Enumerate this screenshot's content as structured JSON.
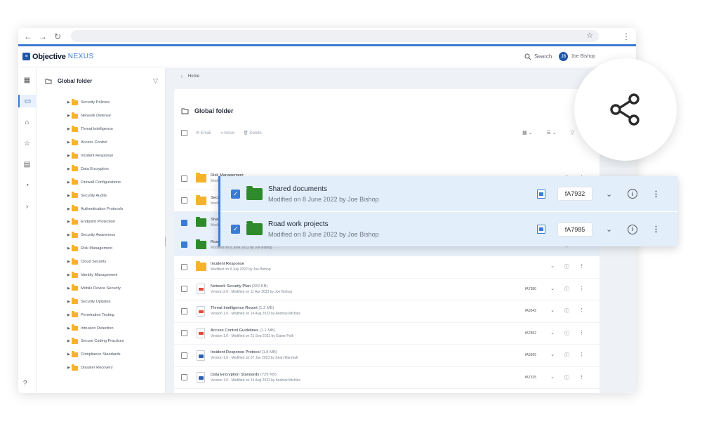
{
  "app": {
    "logo_mark": "≡",
    "logo_primary": "Objective",
    "logo_secondary": "NEXUS",
    "search_label": "Search",
    "user_initials": "JB",
    "user_name": "Joe Bishop"
  },
  "breadcrumb": {
    "label": "Home"
  },
  "tree": {
    "title": "Global folder",
    "items": [
      "Security Policies",
      "Network Defense",
      "Threat Intelligence",
      "Access Control",
      "Incident Response",
      "Data Encryption",
      "Firewall Configurations",
      "Security Audits",
      "Authentication Protocols",
      "Endpoint Protection",
      "Security Awareness",
      "Risk Management",
      "Cloud Security",
      "Identity Management",
      "Mobile Device Security",
      "Security Updates",
      "Penetration Testing",
      "Intrusion Detection",
      "Secure Coding Practices",
      "Compliance Standards",
      "Disaster Recovery"
    ]
  },
  "panel": {
    "title": "Global folder",
    "toolbar": {
      "email": "Email",
      "move": "Move",
      "delete": "Delete"
    }
  },
  "rows": [
    {
      "type": "folder-y",
      "name": "Risk Management",
      "size": "",
      "meta": "Modified on 23 July 2020 by Joe Bishop",
      "id": "fA7932",
      "selected": false
    },
    {
      "type": "folder-y",
      "name": "Security Audits",
      "size": "",
      "meta": "Modified on 8 June 2022 by Joe Bishop",
      "id": "fA7935",
      "selected": false
    },
    {
      "type": "folder-g",
      "name": "Shared documents",
      "size": "",
      "meta": "Modified on 8 June 2022 by Joe Bishop",
      "id": "",
      "selected": true
    },
    {
      "type": "folder-g",
      "name": "Road work projects",
      "size": "",
      "meta": "Modified on 8 June 2022 by Joe Bishop",
      "id": "",
      "selected": true
    },
    {
      "type": "folder-y",
      "name": "Incident Response",
      "size": "",
      "meta": "Modified on 8 July 2022 by Joe Bishop",
      "id": "",
      "selected": false
    },
    {
      "type": "pdf",
      "name": "Network Security Plan",
      "size": "(332 KB)",
      "meta": "Version 2.0 - Modified on 11 Apr 2023 by Joe Bishop",
      "id": "fA7380",
      "selected": false
    },
    {
      "type": "pdf",
      "name": "Threat Intelligence Report",
      "size": "(1.2 MB)",
      "meta": "Version 1.0 - Modified on 14 Aug 2023 by Andrew Michles",
      "id": "fA9342",
      "selected": false
    },
    {
      "type": "pdf",
      "name": "Access Control Guidelines",
      "size": "(1.1 MB)",
      "meta": "Version 1.0 - Modified on 21 Sep 2023 by Elaine Polk",
      "id": "fA7852",
      "selected": false
    },
    {
      "type": "doc",
      "name": "Incident Response Protocol",
      "size": "(1.8 MB)",
      "meta": "Version 1.0 - Modified on 07 Jun 2023 by Sean Marshall",
      "id": "fA9365",
      "selected": false
    },
    {
      "type": "doc",
      "name": "Data Encryption Standards",
      "size": "(729 KB)",
      "meta": "Version 1.0 - Modified on 14 Aug 2023 by Andrew Michles",
      "id": "fA7325",
      "selected": false
    },
    {
      "type": "pdf",
      "name": "Firewall Configuration Guide",
      "size": "(2.5 MB)",
      "meta": "Version 1.0 - Modified on 21 Sep 2023 by Elaine Polk",
      "id": "fA9349",
      "selected": false
    }
  ],
  "overlay": [
    {
      "name": "Shared documents",
      "meta": "Modified on 8 June 2022 by Joe Bishop",
      "id": "fA7932"
    },
    {
      "name": "Road work projects",
      "meta": "Modified on 8 June 2022 by Joe Bishop",
      "id": "fA7985"
    }
  ],
  "colors": {
    "accent": "#3a7bd5",
    "brand": "#1f57a8",
    "folder_yellow": "#f5b22e",
    "folder_green": "#2f8a2c"
  }
}
